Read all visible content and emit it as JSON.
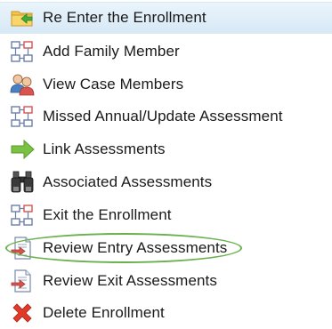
{
  "menu": {
    "items": [
      {
        "label": "Re Enter the Enrollment",
        "icon": "folder-arrow-icon"
      },
      {
        "label": "Add Family Member",
        "icon": "workflow-icon"
      },
      {
        "label": "View Case Members",
        "icon": "users-icon"
      },
      {
        "label": "Missed Annual/Update Assessment",
        "icon": "workflow-icon"
      },
      {
        "label": "Link Assessments",
        "icon": "green-arrow-icon"
      },
      {
        "label": "Associated Assessments",
        "icon": "binoculars-icon"
      },
      {
        "label": "Exit the Enrollment",
        "icon": "workflow-icon"
      },
      {
        "label": "Review Entry Assessments",
        "icon": "document-arrow-icon"
      },
      {
        "label": "Review Exit Assessments",
        "icon": "document-arrow-icon"
      },
      {
        "label": "Delete Enrollment",
        "icon": "red-x-icon"
      }
    ],
    "selected_index": 0,
    "circled_index": 7
  },
  "colors": {
    "selected_bg": "#d7e9f6",
    "highlight_ring": "#6ab04c",
    "delete_red": "#e03a2a",
    "arrow_green": "#7bc142"
  }
}
